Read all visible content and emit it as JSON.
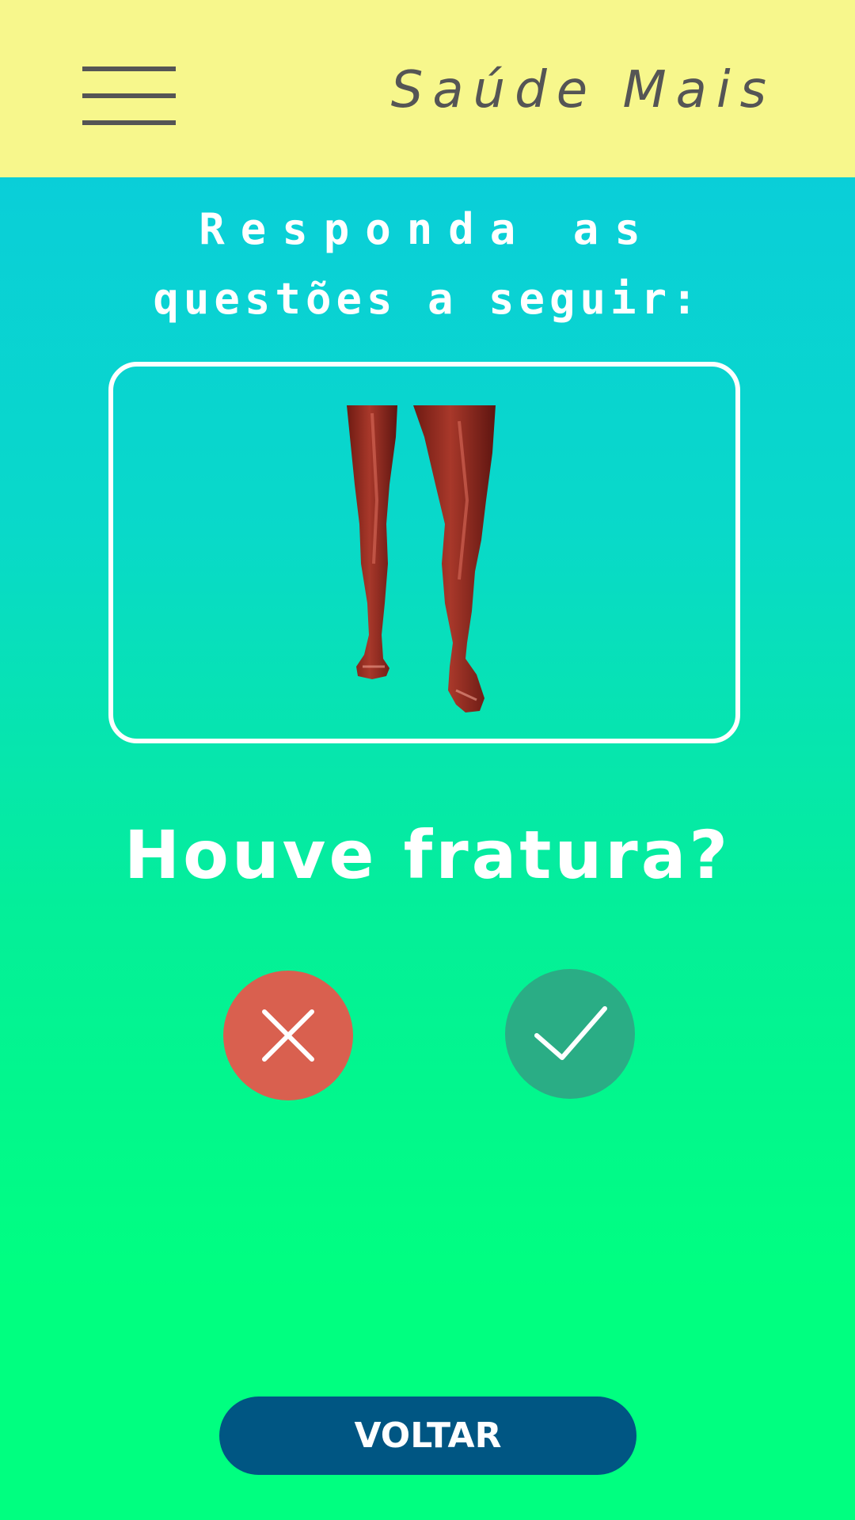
{
  "header": {
    "app_title": "Saúde Mais",
    "menu_icon": "hamburger-menu-icon",
    "background_color": "#f7f78c"
  },
  "main": {
    "instruction_line1": "Responda as",
    "instruction_line2": "questões a seguir:",
    "image_subject": "legs-muscle-anatomy",
    "question": "Houve fratura?",
    "answers": {
      "no_icon": "close-icon",
      "no_color": "#d9604f",
      "yes_icon": "check-icon",
      "yes_color": "#2aad85"
    }
  },
  "footer": {
    "back_label": "VOLTAR",
    "back_color": "#005683"
  }
}
